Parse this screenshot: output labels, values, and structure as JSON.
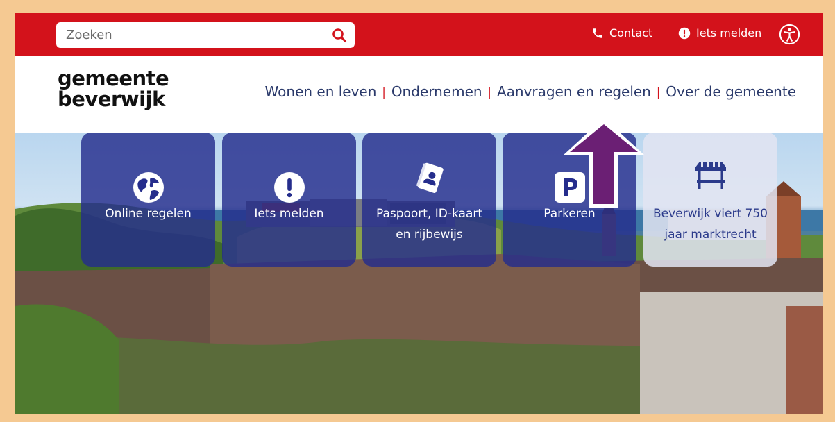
{
  "search": {
    "placeholder": "Zoeken"
  },
  "topbar": {
    "contact_label": "Contact",
    "report_label": "Iets melden"
  },
  "logo": {
    "line1": "gemeente",
    "line2": "beverwijk"
  },
  "nav": [
    {
      "label": "Wonen en leven"
    },
    {
      "label": "Ondernemen"
    },
    {
      "label": "Aanvragen en regelen"
    },
    {
      "label": "Over de gemeente"
    }
  ],
  "tiles": [
    {
      "label": "Online regelen",
      "icon": "globe-icon"
    },
    {
      "label": "Iets melden",
      "icon": "exclamation-icon"
    },
    {
      "label": "Paspoort, ID-kaart en rijbewijs",
      "icon": "passport-icon"
    },
    {
      "label": "Parkeren",
      "icon": "parking-icon"
    },
    {
      "label": "Beverwijk viert 750 jaar marktrecht",
      "icon": "market-stall-icon"
    }
  ],
  "colors": {
    "brand_red": "#d3121b",
    "nav_blue": "#2b3a6b",
    "tile_blue": "#252d8c",
    "arrow_purple": "#6b1f74",
    "frame_orange": "#f5c992"
  }
}
